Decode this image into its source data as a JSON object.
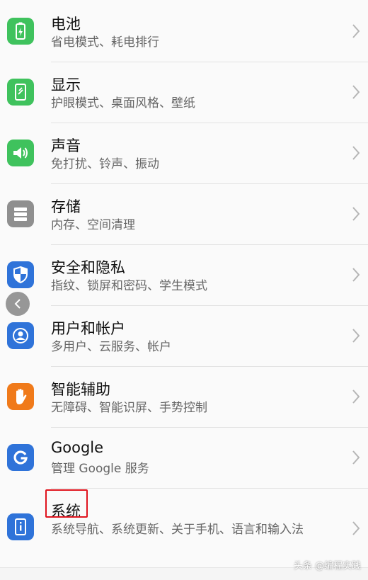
{
  "settings": {
    "items": [
      {
        "title": "电池",
        "subtitle": "省电模式、耗电排行",
        "icon": "battery-icon",
        "color": "#3fc25d"
      },
      {
        "title": "显示",
        "subtitle": "护眼模式、桌面风格、壁纸",
        "icon": "display-icon",
        "color": "#3fc25d"
      },
      {
        "title": "声音",
        "subtitle": "免打扰、铃声、振动",
        "icon": "sound-icon",
        "color": "#3fc25d"
      },
      {
        "title": "存储",
        "subtitle": "内存、空间清理",
        "icon": "storage-icon",
        "color": "#8f8f8f"
      },
      {
        "title": "安全和隐私",
        "subtitle": "指纹、锁屏和密码、学生模式",
        "icon": "shield-icon",
        "color": "#2f73d9"
      },
      {
        "title": "用户和帐户",
        "subtitle": "多用户、云服务、帐户",
        "icon": "user-icon",
        "color": "#2f73d9"
      },
      {
        "title": "智能辅助",
        "subtitle": "无障碍、智能识屏、手势控制",
        "icon": "hand-icon",
        "color": "#f07a1a"
      },
      {
        "title": "Google",
        "subtitle": "管理 Google 服务",
        "icon": "google-icon",
        "color": "#2f73d9"
      },
      {
        "title": "系统",
        "subtitle": "系统导航、系统更新、关于手机、语言和输入法",
        "icon": "system-info-icon",
        "color": "#2f73d9"
      }
    ]
  },
  "watermark": "头条 @编程实践",
  "highlight_color": "#e0141e"
}
